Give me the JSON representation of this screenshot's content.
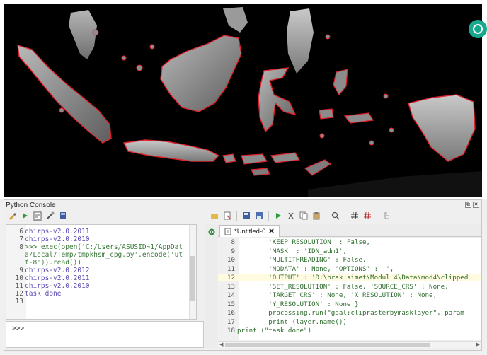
{
  "colors": {
    "map_background": "#000000",
    "land_fill": "#8a8a8a",
    "border": "#e0202a",
    "keyword": "#1f3fa6",
    "string": "#2f6e2f",
    "output_text": "#5c4bb2",
    "accent_widget": "#17a88d"
  },
  "console": {
    "title": "Python Console",
    "left_toolbar_icons": [
      "clear-console-icon",
      "run-command-icon",
      "show-editor-icon",
      "settings-icon",
      "help-icon"
    ],
    "right_toolbar_icons": [
      "open-script-icon",
      "open-in-external-editor-icon",
      "save-icon",
      "save-as-icon",
      "run-script-icon",
      "cut-icon",
      "copy-icon",
      "paste-icon",
      "find-icon",
      "comment-icon",
      "uncomment-icon",
      "object-inspector-icon"
    ],
    "input_prompt": ">>>",
    "output_lines": [
      {
        "num": "6",
        "text": "chirps-v2.0.2011"
      },
      {
        "num": "7",
        "text": "chirps-v2.0.2010"
      },
      {
        "num": "8",
        "text": ">>> exec(open('C:/Users/ASUSID~1/AppDat"
      },
      {
        "num": "",
        "text": "a/Local/Temp/tmpkhsm_cpg.py'.encode('ut"
      },
      {
        "num": "",
        "text": "f-8')).read())"
      },
      {
        "num": "9",
        "text": "chirps-v2.0.2012"
      },
      {
        "num": "10",
        "text": "chirps-v2.0.2011"
      },
      {
        "num": "11",
        "text": "chirps-v2.0.2010"
      },
      {
        "num": "12",
        "text": "task done"
      },
      {
        "num": "13",
        "text": ""
      }
    ]
  },
  "editor": {
    "tab_title": "*Untitled-0",
    "tab_close": "✕",
    "lines": [
      {
        "num": "8",
        "text": "        'KEEP_RESOLUTION' : False,"
      },
      {
        "num": "9",
        "text": "        'MASK' : 'IDN_adm1',"
      },
      {
        "num": "10",
        "text": "        'MULTITHREADING' : False,"
      },
      {
        "num": "11",
        "text": "        'NODATA' : None, 'OPTIONS' : '',"
      },
      {
        "num": "12",
        "text": "        'OUTPUT' : 'D:\\prak simet\\Modul 4\\Data\\mod4\\clipped"
      },
      {
        "num": "13",
        "text": "        'SET_RESOLUTION' : False, 'SOURCE_CRS' : None,"
      },
      {
        "num": "14",
        "text": "        'TARGET_CRS' : None, 'X_RESOLUTION' : None,"
      },
      {
        "num": "15",
        "text": "        'Y_RESOLUTION' : None }"
      },
      {
        "num": "16",
        "text": "        processing.run(\"gdal:cliprasterbymasklayer\", param"
      },
      {
        "num": "17",
        "text": "        print (layer.name())"
      },
      {
        "num": "18",
        "text": "print (\"task done\")"
      }
    ]
  }
}
